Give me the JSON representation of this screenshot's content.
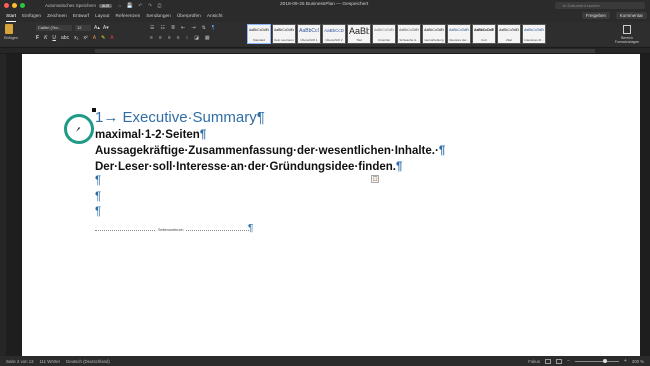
{
  "titlebar": {
    "autosave_label": "Automatisches Speichern",
    "autosave_toggle": "AUS",
    "document_title": "2018-09-25 BusinessPlan — Gespeichert",
    "search_placeholder": "In Dokument suchen"
  },
  "tabs": [
    "Start",
    "Einfügen",
    "Zeichnen",
    "Entwurf",
    "Layout",
    "Referenzen",
    "Sendungen",
    "Überprüfen",
    "Ansicht"
  ],
  "actions": {
    "share": "Freigeben",
    "comments": "Kommentar"
  },
  "ribbon": {
    "paste_label": "Einfügen",
    "font_name": "Calibri (Tex...",
    "font_size": "12",
    "styles": [
      {
        "sample": "AaBbCcDdEe",
        "name": "Standard"
      },
      {
        "sample": "AaBbCcDdEe",
        "name": "Kein Leerraum"
      },
      {
        "sample": "AaBbCcI",
        "name": "Überschrift 1"
      },
      {
        "sample": "AaBbCcD",
        "name": "Überschrift 2"
      },
      {
        "sample": "AaBbI",
        "name": "Titel"
      },
      {
        "sample": "AaBbCcDdEe",
        "name": "Untertitel"
      },
      {
        "sample": "AaBbCcDdEe",
        "name": "Schwache H..."
      },
      {
        "sample": "AaBbCcDdEe",
        "name": "Hervorhebung"
      },
      {
        "sample": "AaBbCcDdEe",
        "name": "Intensive Her..."
      },
      {
        "sample": "AaBbCcDdEe",
        "name": "Fett"
      },
      {
        "sample": "AaBbCcDdEe",
        "name": "Zitat"
      },
      {
        "sample": "AaBbCcDdEe",
        "name": "Intensives Zi..."
      }
    ],
    "styles_pane_label": "Bereich Formatvorlagen"
  },
  "document": {
    "heading_number": "1",
    "heading_text": "Executive·Summary",
    "line1": "maximal·1-2·Seiten",
    "line2": "Aussagekräftige·Zusammenfassung·der·wesentlichen·Inhalte.·",
    "line3": "Der·Leser·soll·Interesse·an·der·Gründungsidee·finden.",
    "pilcrow": "¶",
    "page_break_label": "Seitenumbruch"
  },
  "statusbar": {
    "page": "Seite 2 von 13",
    "words": "111 Wörter",
    "language": "Deutsch (Deutschland)",
    "focus": "Fokus",
    "zoom": "200 %"
  },
  "colors": {
    "accent": "#2f6ea6",
    "highlight_circle": "#1e9b87"
  }
}
